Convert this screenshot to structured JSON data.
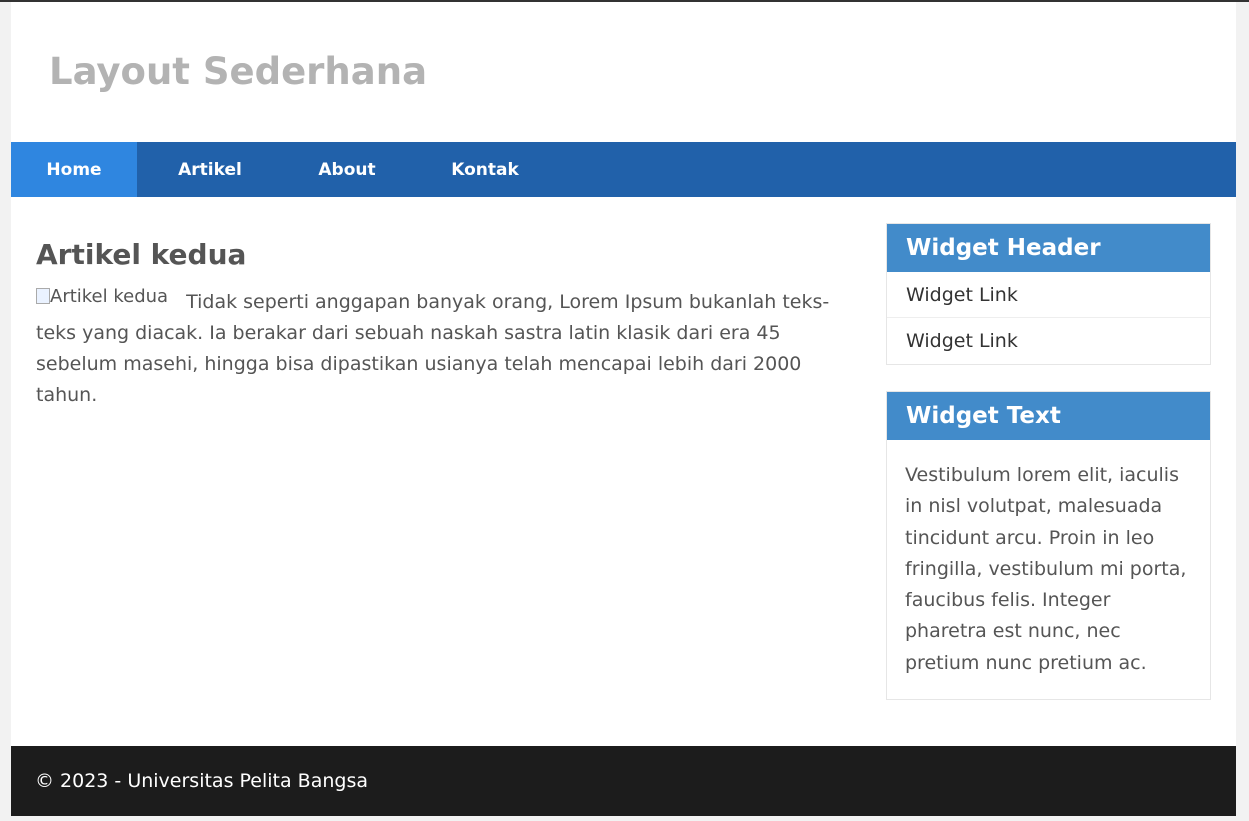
{
  "header": {
    "title": "Layout Sederhana"
  },
  "nav": {
    "items": [
      {
        "label": "Home"
      },
      {
        "label": "Artikel"
      },
      {
        "label": "About"
      },
      {
        "label": "Kontak"
      }
    ]
  },
  "main": {
    "title": "Artikel kedua",
    "image_alt": "Artikel kedua",
    "body": "Tidak seperti anggapan banyak orang, Lorem Ipsum bukanlah teks-teks yang diacak. Ia berakar dari sebuah naskah sastra latin klasik dari era 45 sebelum masehi, hingga bisa dipastikan usianya telah mencapai lebih dari 2000 tahun."
  },
  "sidebar": {
    "widget_links": {
      "header": "Widget Header",
      "links": [
        "Widget Link",
        "Widget Link"
      ]
    },
    "widget_text": {
      "header": "Widget Text",
      "text": "Vestibulum lorem elit, iaculis in nisl volutpat, malesuada tincidunt arcu. Proin in leo fringilla, vestibulum mi porta, faucibus felis. Integer pharetra est nunc, nec pretium nunc pretium ac."
    }
  },
  "footer": {
    "text": "© 2023 - Universitas Pelita Bangsa"
  },
  "colors": {
    "nav_bg": "#2161aa",
    "nav_active": "#2f86e0",
    "widget_header": "#428bca",
    "footer_bg": "#1c1c1c"
  }
}
